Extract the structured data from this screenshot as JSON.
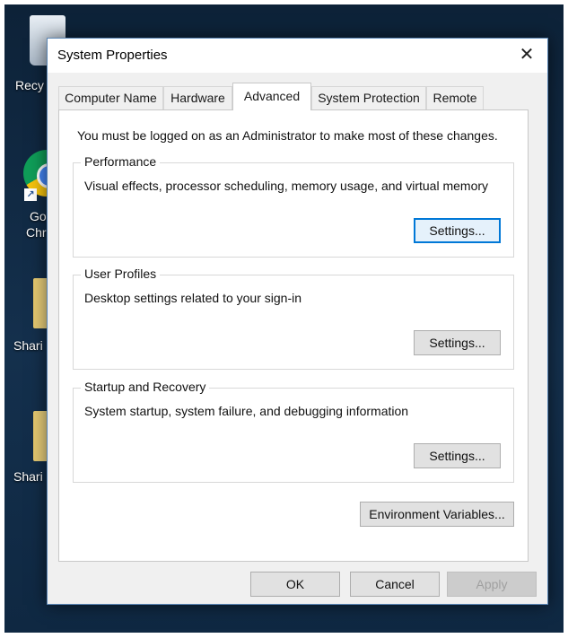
{
  "desktop": {
    "labels": [
      "Recy",
      "Go",
      "Chr",
      "Shari",
      "Shari"
    ]
  },
  "dialog": {
    "title": "System Properties",
    "close_glyph": "✕",
    "tabs": [
      {
        "label": "Computer Name",
        "active": false
      },
      {
        "label": "Hardware",
        "active": false
      },
      {
        "label": "Advanced",
        "active": true
      },
      {
        "label": "System Protection",
        "active": false
      },
      {
        "label": "Remote",
        "active": false
      }
    ],
    "admin_note": "You must be logged on as an Administrator to make most of these changes.",
    "groups": [
      {
        "title": "Performance",
        "description": "Visual effects, processor scheduling, memory usage, and virtual memory",
        "button": "Settings..."
      },
      {
        "title": "User Profiles",
        "description": "Desktop settings related to your sign-in",
        "button": "Settings..."
      },
      {
        "title": "Startup and Recovery",
        "description": "System startup, system failure, and debugging information",
        "button": "Settings..."
      }
    ],
    "env_button": "Environment Variables...",
    "footer": {
      "ok": "OK",
      "cancel": "Cancel",
      "apply": "Apply"
    }
  },
  "colors": {
    "focus_accent": "#0078d7",
    "dialog_background": "#f0f0f0"
  }
}
